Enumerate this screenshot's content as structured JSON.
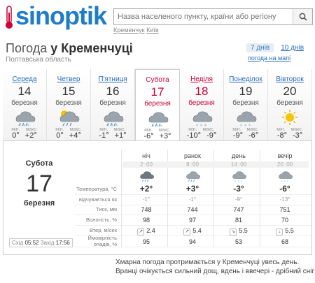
{
  "header": {
    "logo_text": "sinoptik",
    "search_placeholder": "Назва населеного пункту, країни або регіону",
    "recent_links": [
      "Кременчук",
      "Київ"
    ]
  },
  "location": {
    "title_prefix": "Погода",
    "title_city": "у Кременчуці",
    "region": "Полтавська область"
  },
  "range_tabs": {
    "active": "7 днів",
    "other": "10 днів",
    "map_link": "погода на мапі"
  },
  "days": [
    {
      "name": "Середа",
      "date": "14",
      "month": "березня",
      "icon": "cloud-rain-snow-icon",
      "min_label": "мін.",
      "max_label": "макс.",
      "min": "0°",
      "max": "+2°",
      "weekend": false,
      "active": false
    },
    {
      "name": "Четвер",
      "date": "15",
      "month": "березня",
      "icon": "sun-cloud-rain-icon",
      "min_label": "мін.",
      "max_label": "макс.",
      "min": "0°",
      "max": "+4°",
      "weekend": false,
      "active": false
    },
    {
      "name": "П'ятниця",
      "date": "16",
      "month": "березня",
      "icon": "cloud-rain-snow-icon",
      "min_label": "мін.",
      "max_label": "макс.",
      "min": "-1°",
      "max": "+1°",
      "weekend": false,
      "active": false
    },
    {
      "name": "Субота",
      "date": "17",
      "month": "березня",
      "icon": "cloud-rain-snow-icon",
      "min_label": "мін.",
      "max_label": "макс.",
      "min": "-6°",
      "max": "+3°",
      "weekend": true,
      "active": true
    },
    {
      "name": "Неділя",
      "date": "18",
      "month": "березня",
      "icon": "cloud-snow-icon",
      "min_label": "мін.",
      "max_label": "макс.",
      "min": "-10°",
      "max": "-9°",
      "weekend": true,
      "active": false
    },
    {
      "name": "Понеділок",
      "date": "19",
      "month": "березня",
      "icon": "cloud-snow-icon",
      "min_label": "мін.",
      "max_label": "макс.",
      "min": "-9°",
      "max": "-6°",
      "weekend": false,
      "active": false
    },
    {
      "name": "Вівторок",
      "date": "20",
      "month": "березня",
      "icon": "sun-icon",
      "min_label": "мін.",
      "max_label": "макс.",
      "min": "-8°",
      "max": "-3°",
      "weekend": false,
      "active": false
    }
  ],
  "detail": {
    "weekday": "Субота",
    "date": "17",
    "month": "березня",
    "sunrise_label": "Схід",
    "sunrise": "05:52",
    "sunset_label": "Захід",
    "sunset": "17:56",
    "periods": [
      {
        "name": "ніч",
        "time": "2 :00",
        "icon": "cloud-heavy-rain-icon",
        "temp": "+2°",
        "feels": "-1°",
        "pressure": "748",
        "humidity": "98",
        "wind_dir": "↗",
        "wind": "2.4",
        "precip": "95"
      },
      {
        "name": "ранок",
        "time": "8 :00",
        "icon": "cloud-rain-icon",
        "temp": "+3°",
        "feels": "-1°",
        "pressure": "744",
        "humidity": "97",
        "wind_dir": "↗",
        "wind": "5.4",
        "precip": "94"
      },
      {
        "name": "день",
        "time": "14 :00",
        "icon": "cloud-light-snow-icon",
        "temp": "-3°",
        "feels": "-9°",
        "pressure": "747",
        "humidity": "81",
        "wind_dir": "↘",
        "wind": "5.5",
        "precip": "53"
      },
      {
        "name": "вечір",
        "time": "20 :00",
        "icon": "cloud-snow-icon",
        "temp": "-6°",
        "feels": "-13°",
        "pressure": "751",
        "humidity": "70",
        "wind_dir": "↓",
        "wind": "5.5",
        "precip": "68"
      }
    ],
    "row_labels": {
      "temp": "Температура, °C",
      "feels": "відчувається як",
      "pressure": "Тиск, мм",
      "humidity": "Вологість, %",
      "wind": "Втер, м/сек",
      "precip": "Ймовірність опадів, %"
    }
  },
  "description": {
    "line1": "Хмарна погода протримається у Кременчуці увесь день.",
    "line2": "Вранці очікується сильний дощ, вдень і ввечері - дрібний сніг"
  },
  "colors": {
    "brand": "#1f7cc7",
    "link": "#2a6ebb",
    "weekend": "#cc0033"
  }
}
